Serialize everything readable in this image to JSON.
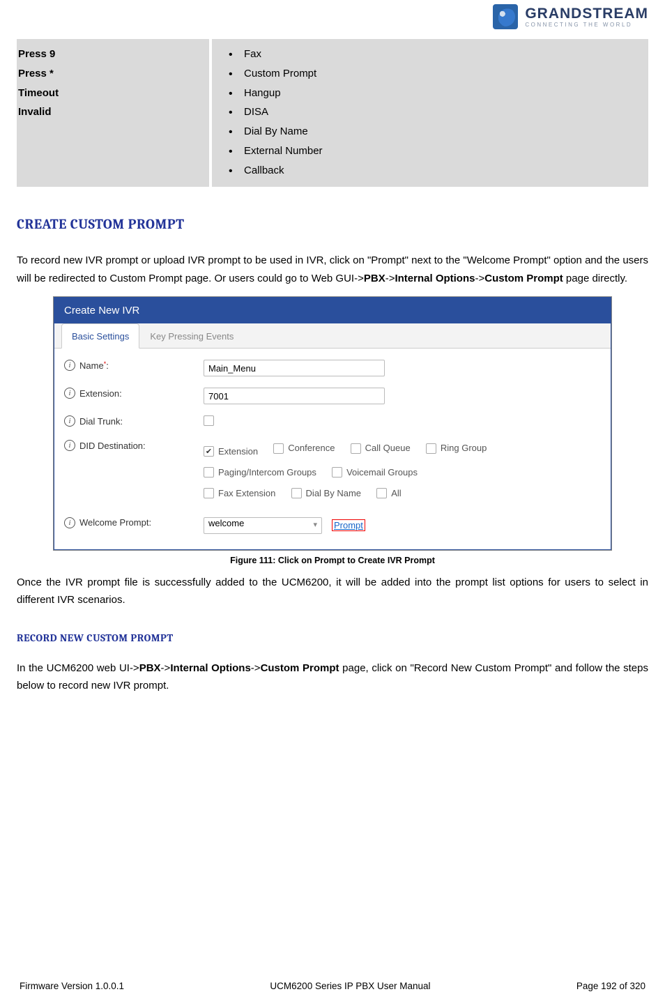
{
  "brand": {
    "name": "GRANDSTREAM",
    "tagline": "CONNECTING THE WORLD"
  },
  "key_table": {
    "left_items": [
      "Press 9",
      "Press *",
      "Timeout",
      "Invalid"
    ],
    "right_items": [
      "Fax",
      "Custom Prompt",
      "Hangup",
      "DISA",
      "Dial By Name",
      "External Number",
      "Callback"
    ]
  },
  "heading_create": "CREATE CUSTOM PROMPT",
  "para_create_1": "To record new IVR prompt or upload IVR prompt to be used in IVR, click on \"Prompt\" next to the \"Welcome Prompt\" option and the users will be redirected to Custom Prompt page. Or users could go to Web GUI->",
  "para_create_path_1": "PBX",
  "para_create_sep": "->",
  "para_create_path_2": "Internal Options",
  "para_create_path_3": "Custom Prompt",
  "para_create_tail": " page directly.",
  "figure": {
    "titlebar": "Create New IVR",
    "tab_active": "Basic Settings",
    "tab_inactive": "Key Pressing Events",
    "rows": {
      "name_label": "Name",
      "name_value": "Main_Menu",
      "ext_label": "Extension:",
      "ext_value": "7001",
      "dial_trunk_label": "Dial Trunk:",
      "did_label": "DID Destination:",
      "did_options_line1": [
        "Extension",
        "Conference",
        "Call Queue",
        "Ring Group"
      ],
      "did_options_line2": [
        "Paging/Intercom Groups",
        "Voicemail Groups"
      ],
      "did_options_line3": [
        "Fax Extension",
        "Dial By Name",
        "All"
      ],
      "did_checked_index": 0,
      "welcome_label": "Welcome Prompt:",
      "welcome_value": "welcome",
      "prompt_link": "Prompt"
    },
    "caption": "Figure 111: Click on Prompt to Create IVR Prompt"
  },
  "para_after_figure": "Once the IVR prompt file is successfully added to the UCM6200, it will be added into the prompt list options for users to select in different IVR scenarios.",
  "heading_record": "RECORD NEW CUSTOM PROMPT",
  "para_record_pre": "In the UCM6200 web UI->",
  "para_record_path_1": "PBX",
  "para_record_path_2": "Internal Options",
  "para_record_path_3": "Custom Prompt",
  "para_record_tail": " page, click on \"Record New Custom Prompt\" and follow the steps below to record new IVR prompt.",
  "footer": {
    "left": "Firmware Version 1.0.0.1",
    "center": "UCM6200 Series IP PBX User Manual",
    "right": "Page 192 of 320"
  }
}
